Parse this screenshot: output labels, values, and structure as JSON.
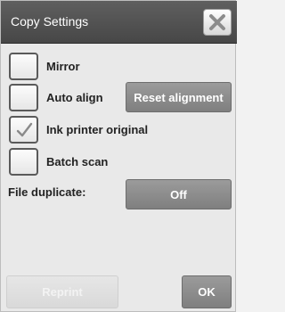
{
  "dialog": {
    "title": "Copy Settings",
    "close_icon": "close-x-icon"
  },
  "options": [
    {
      "label": "Mirror",
      "checked": false
    },
    {
      "label": "Auto align",
      "checked": false
    },
    {
      "label": "Ink printer original",
      "checked": true
    },
    {
      "label": "Batch scan",
      "checked": false
    }
  ],
  "auto_align": {
    "reset_label": "Reset alignment"
  },
  "file_duplicate": {
    "label": "File duplicate:",
    "value": "Off"
  },
  "footer": {
    "reprint_label": "Reprint",
    "reprint_enabled": false,
    "ok_label": "OK"
  },
  "colors": {
    "title_bar": "#4f4f4f",
    "button_gray": "#8a8a8a",
    "background": "#e9e9e9"
  }
}
